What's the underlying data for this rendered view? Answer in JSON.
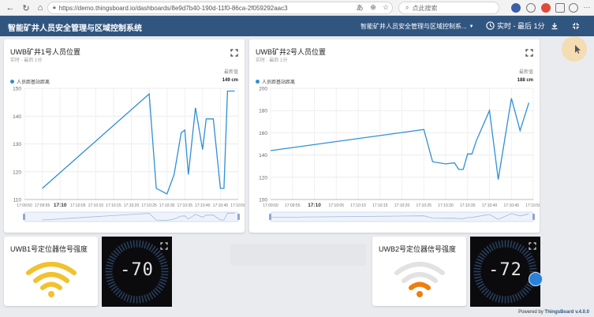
{
  "browser": {
    "url": "https://demo.thingsboard.io/dashboards/8e9d7b40-190d-11f0-86ca-2f059292aac3",
    "search_placeholder": "点此搜索"
  },
  "toolbar": {
    "title": "智能矿井人员安全管理与区域控制系统",
    "state_label": "智能矿井人员安全管理与区域控制系...",
    "timewindow_label": "实时 - 最后 1分"
  },
  "widgets": {
    "chart1": {
      "title": "UWB矿井1号人员位置",
      "subtitle": "实时 · 最后 1分",
      "latest_header": "最新值",
      "legend": "人员距基站距离",
      "latest_value": "149 cm"
    },
    "chart2": {
      "title": "UWB矿井2号人员位置",
      "subtitle": "实时 · 最后 1分",
      "latest_header": "最新值",
      "legend": "人员距基站距离",
      "latest_value": "188 cm"
    },
    "signal1": {
      "title": "UWB1号定位器信号强度",
      "level": 3,
      "color": "#f2c12e"
    },
    "signal2": {
      "title": "UWB2号定位器信号强度",
      "level": 1,
      "color": "#f07d0c"
    },
    "gauge1": {
      "value": "-70"
    },
    "gauge2": {
      "value": "-72"
    }
  },
  "footer": {
    "prefix": "Powered by ",
    "brand": "ThingsBoard",
    "version": " v.4.0.0"
  },
  "colors": {
    "toolbar": "#305680",
    "series": "#2e8fd6",
    "gauge_bg": "#0b0b0e"
  },
  "chart_data": [
    {
      "type": "line",
      "title": "UWB矿井1号人员位置",
      "series": [
        {
          "name": "人员距基站距离",
          "x": [
            "17:09:55",
            "17:10:25",
            "17:10:27",
            "17:10:30",
            "17:10:32",
            "17:10:34",
            "17:10:35",
            "17:10:36",
            "17:10:38",
            "17:10:40",
            "17:10:41",
            "17:10:43",
            "17:10:45",
            "17:10:46",
            "17:10:47",
            "17:10:48",
            "17:10:49"
          ],
          "values": [
            114,
            148,
            114,
            112,
            119,
            134,
            135,
            119,
            143,
            128,
            139,
            139,
            114,
            114,
            149,
            149,
            149
          ]
        }
      ],
      "yticks": [
        110,
        120,
        130,
        140,
        150
      ],
      "ylim": [
        110,
        150
      ],
      "xticks": [
        "17:09:50",
        "17:09:55",
        "17:10",
        "17:10:05",
        "17:10:10",
        "17:10:15",
        "17:10:20",
        "17:10:25",
        "17:10:30",
        "17:10:35",
        "17:10:40",
        "17:10:45",
        "17:10:50"
      ],
      "x_bold_tick": "17:10",
      "grid": true
    },
    {
      "type": "line",
      "title": "UWB矿井2号人员位置",
      "series": [
        {
          "name": "人员距基站距离",
          "x": [
            "17:09:50",
            "17:10:25",
            "17:10:27",
            "17:10:30",
            "17:10:32",
            "17:10:33",
            "17:10:34",
            "17:10:35",
            "17:10:36",
            "17:10:37",
            "17:10:40",
            "17:10:42",
            "17:10:45",
            "17:10:47",
            "17:10:49"
          ],
          "values": [
            144,
            163,
            134,
            132,
            133,
            127,
            127,
            141,
            141,
            153,
            180,
            118,
            191,
            162,
            187
          ]
        }
      ],
      "yticks": [
        100,
        120,
        140,
        160,
        180,
        200
      ],
      "ylim": [
        100,
        200
      ],
      "xticks": [
        "17:09:50",
        "17:09:55",
        "17:10",
        "17:10:05",
        "17:10:10",
        "17:10:15",
        "17:10:20",
        "17:10:25",
        "17:10:30",
        "17:10:35",
        "17:10:40",
        "17:10:45",
        "17:10:50"
      ],
      "x_bold_tick": "17:10",
      "grid": true
    }
  ]
}
